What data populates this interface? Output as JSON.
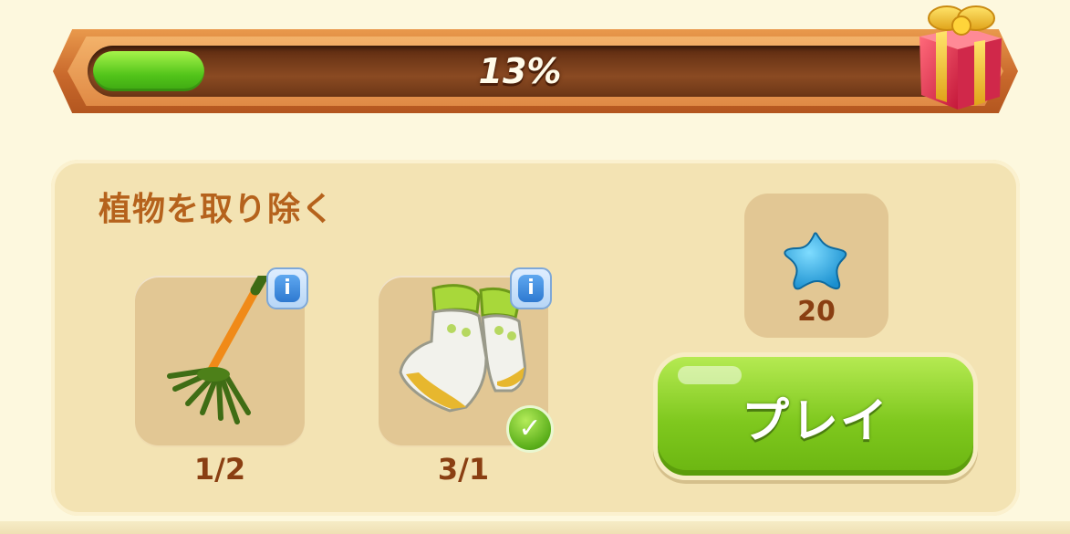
{
  "progress": {
    "percent_label": "13%",
    "fill_fraction": 0.13
  },
  "gift": {
    "icon": "gift-box-icon"
  },
  "task": {
    "title": "植物を取り除く",
    "items": [
      {
        "icon": "rake-icon",
        "count_label": "1/2",
        "info_icon": "info-icon",
        "completed": false
      },
      {
        "icon": "gardening-gloves-icon",
        "count_label": "3/1",
        "info_icon": "info-icon",
        "completed": true
      }
    ],
    "check_mark": "✓"
  },
  "reward": {
    "icon": "blue-star-icon",
    "count_label": "20"
  },
  "play_button": {
    "label": "プレイ"
  },
  "colors": {
    "background": "#fdf8de",
    "panel": "#f3e3b3",
    "title_text": "#b5621c",
    "count_text": "#8a3f12",
    "progress_fill": "#52c41a",
    "play_button": "#7fc81e"
  }
}
